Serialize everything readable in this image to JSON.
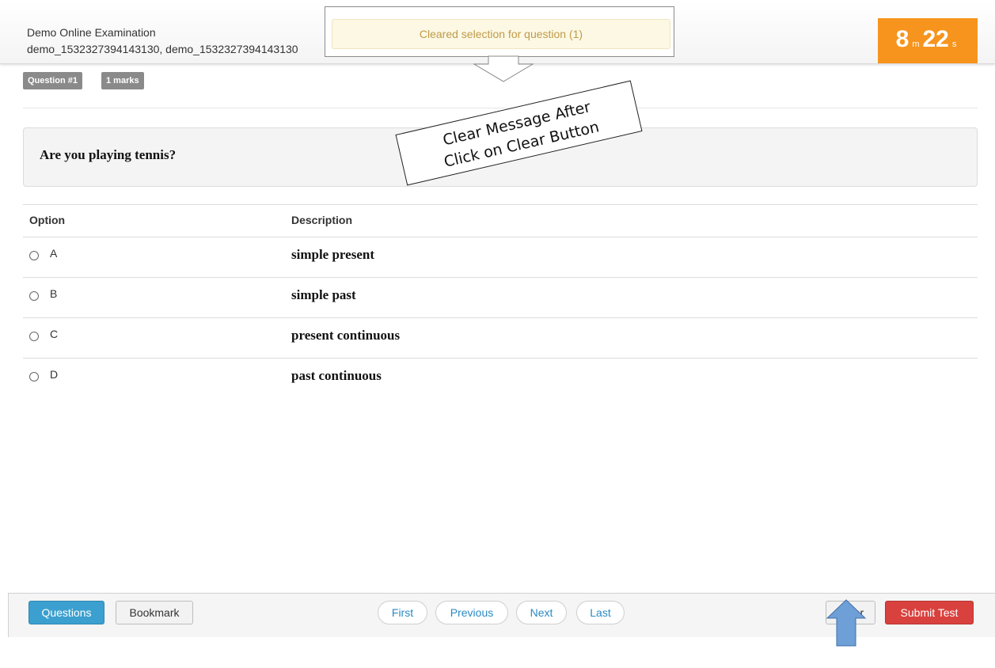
{
  "header": {
    "title": "Demo Online Examination",
    "ids": "demo_1532327394143130, demo_1532327394143130"
  },
  "toast": {
    "message": "Cleared selection for question (1)"
  },
  "timer": {
    "minutes": "8",
    "minutes_unit": "m",
    "seconds": "22",
    "seconds_unit": "s"
  },
  "badges": {
    "question": "Question #1",
    "marks": "1 marks"
  },
  "question": {
    "text": "Are you playing tennis?"
  },
  "table": {
    "headers": {
      "option": "Option",
      "description": "Description"
    },
    "options": [
      {
        "letter": "A",
        "description": "simple present"
      },
      {
        "letter": "B",
        "description": "simple past"
      },
      {
        "letter": "C",
        "description": "present continuous"
      },
      {
        "letter": "D",
        "description": "past continuous"
      }
    ]
  },
  "footer": {
    "questions_label": "Questions",
    "bookmark_label": "Bookmark",
    "first_label": "First",
    "previous_label": "Previous",
    "next_label": "Next",
    "last_label": "Last",
    "clear_label": "Clear",
    "submit_label": "Submit Test"
  },
  "annotation": {
    "line1": "Clear Message After",
    "line2": "Click on Clear Button",
    "arrow_color": "#6e9fd6"
  },
  "colors": {
    "timer": "#f7941d",
    "primary": "#3ba0cf",
    "danger": "#d9413e",
    "toast_bg": "#fcf8e3"
  }
}
